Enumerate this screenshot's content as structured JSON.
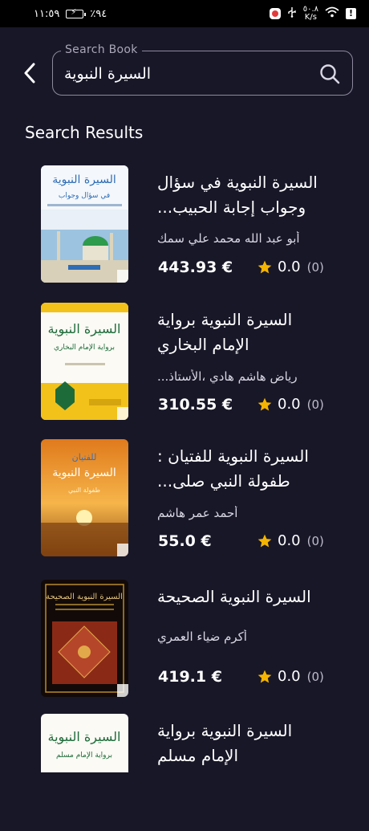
{
  "status_bar": {
    "time": "١١:٥٩",
    "battery": "٪٩٤",
    "net_speed_top": "٥٠.٨",
    "net_speed_bottom": "K/s"
  },
  "search": {
    "legend": "Search Book",
    "value": "السيرة النبوية"
  },
  "results_title": "Search Results",
  "colors": {
    "background": "#181728",
    "star": "#f5b400"
  },
  "results": [
    {
      "title": "السيرة النبوية في سؤال وجواب إجابة الحبيب...",
      "author": "أبو عبد الله محمد علي سمك",
      "price": "443.93 €",
      "rating": "0.0",
      "rating_count": "(0)"
    },
    {
      "title": "السيرة النبوية برواية الإمام البخاري",
      "author": "رياض هاشم هادي ،الأستاذ...",
      "price": "310.55 €",
      "rating": "0.0",
      "rating_count": "(0)"
    },
    {
      "title": "السيرة النبوية للفتيان : طفولة النبي صلى...",
      "author": "أحمد عمر هاشم",
      "price": "55.0 €",
      "rating": "0.0",
      "rating_count": "(0)"
    },
    {
      "title": "السيرة النبوية الصحيحة",
      "author": "أكرم ضياء العمري",
      "price": "419.1 €",
      "rating": "0.0",
      "rating_count": "(0)"
    },
    {
      "title": "السيرة النبوية برواية الإمام مسلم",
      "author": "",
      "price": "",
      "rating": "",
      "rating_count": ""
    }
  ]
}
